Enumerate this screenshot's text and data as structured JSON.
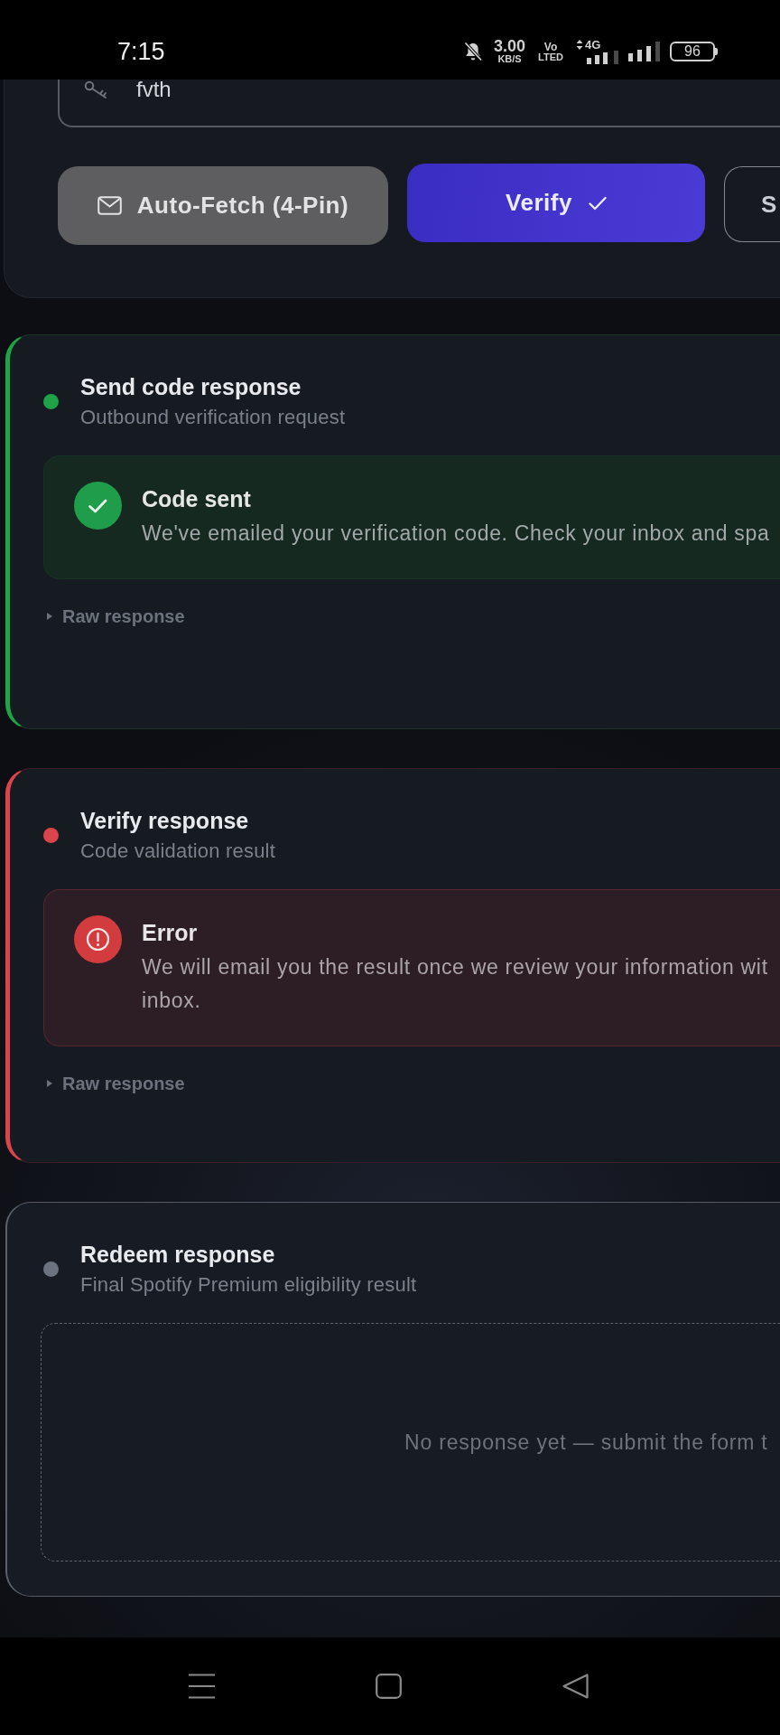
{
  "status_bar": {
    "time": "7:15",
    "speed_value": "3.00",
    "speed_unit": "KB/S",
    "volte_top": "Vo",
    "volte_bottom": "LTED",
    "network_type": "4G",
    "battery": "96"
  },
  "code_field": {
    "value": "fvth"
  },
  "actions": [
    {
      "label": "Auto-Fetch (4-Pin)",
      "kind": "filled"
    },
    {
      "label": "Verify",
      "kind": "primary"
    },
    {
      "label": "S",
      "kind": "outline"
    }
  ],
  "cards": [
    {
      "kind": "success",
      "color": "#1fa347",
      "title": "Send code response",
      "subtitle": "Outbound verification request",
      "result": {
        "heading": "Code sent",
        "message_lines": [
          "We've emailed your verification code. Check your inbox and spa"
        ]
      },
      "raw": {
        "label": "Raw response",
        "expanded": false
      }
    },
    {
      "kind": "error",
      "color": "#d9454a",
      "title": "Verify response",
      "subtitle": "Code validation result",
      "result": {
        "heading": "Error",
        "message_lines": [
          "We will email you the result once we review your information wit",
          "inbox."
        ]
      },
      "raw": {
        "label": "Raw response",
        "expanded": false
      }
    },
    {
      "kind": "pending",
      "color": "#6b7280",
      "title": "Redeem response",
      "subtitle": "Final Spotify Premium eligibility result",
      "empty_text": "No response yet — submit the form t"
    }
  ]
}
